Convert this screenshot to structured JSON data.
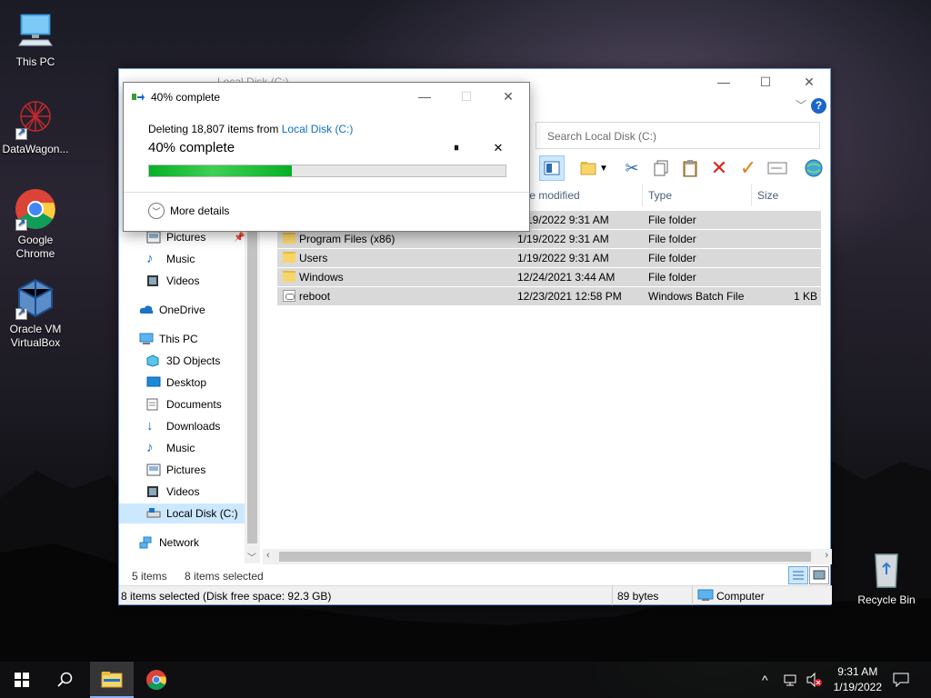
{
  "desktop": {
    "icons": [
      {
        "label": "This PC",
        "icon": "this-pc-icon"
      },
      {
        "label": "DataWagon...",
        "icon": "datawagon-icon"
      },
      {
        "label": "Google Chrome",
        "icon": "chrome-icon"
      },
      {
        "label": "Oracle VM VirtualBox",
        "icon": "virtualbox-icon"
      },
      {
        "label": "Recycle Bin",
        "icon": "recycle-bin-icon"
      }
    ]
  },
  "explorer": {
    "title": "Local Disk (C:)",
    "search_placeholder": "Search Local Disk (C:)",
    "columns": [
      "te modified",
      "Type",
      "Size"
    ],
    "nav": [
      {
        "label": "Pictures",
        "icon": "pictures-icon",
        "pinned": true
      },
      {
        "label": "Music",
        "icon": "music-icon"
      },
      {
        "label": "Videos",
        "icon": "videos-icon"
      },
      {
        "label": "OneDrive",
        "icon": "onedrive-icon"
      },
      {
        "label": "This PC",
        "icon": "this-pc-icon"
      },
      {
        "label": "3D Objects",
        "icon": "3d-objects-icon"
      },
      {
        "label": "Desktop",
        "icon": "desktop-icon"
      },
      {
        "label": "Documents",
        "icon": "documents-icon"
      },
      {
        "label": "Downloads",
        "icon": "downloads-icon"
      },
      {
        "label": "Music",
        "icon": "music-icon"
      },
      {
        "label": "Pictures",
        "icon": "pictures-icon"
      },
      {
        "label": "Videos",
        "icon": "videos-icon"
      },
      {
        "label": "Local Disk (C:)",
        "icon": "drive-icon",
        "selected": true
      },
      {
        "label": "Network",
        "icon": "network-icon"
      }
    ],
    "files": [
      {
        "name": "",
        "date": "1/19/2022 9:31 AM",
        "type": "File folder",
        "size": "",
        "icon": "folder-icon"
      },
      {
        "name": "Program Files (x86)",
        "date": "1/19/2022 9:31 AM",
        "type": "File folder",
        "size": "",
        "icon": "folder-icon"
      },
      {
        "name": "Users",
        "date": "1/19/2022 9:31 AM",
        "type": "File folder",
        "size": "",
        "icon": "folder-icon"
      },
      {
        "name": "Windows",
        "date": "12/24/2021 3:44 AM",
        "type": "File folder",
        "size": "",
        "icon": "folder-icon"
      },
      {
        "name": "reboot",
        "date": "12/23/2021 12:58 PM",
        "type": "Windows Batch File",
        "size": "1 KB",
        "icon": "batch-file-icon"
      }
    ],
    "status": {
      "items": "5 items",
      "selected": "8 items selected"
    },
    "bottom": {
      "info": "8 items selected (Disk free space: 92.3 GB)",
      "bytes": "89 bytes",
      "location": "Computer"
    }
  },
  "dialog": {
    "title": "40% complete",
    "subtitle_prefix": "Deleting 18,807 items from ",
    "subtitle_link": "Local Disk (C:)",
    "percent_label": "40% complete",
    "progress": 0.4,
    "more_details": "More details"
  },
  "taskbar": {
    "time": "9:31 AM",
    "date": "1/19/2022"
  },
  "colors": {
    "accent": "#0078d7",
    "progress": "#06b025",
    "selection": "#d9d9d9"
  }
}
